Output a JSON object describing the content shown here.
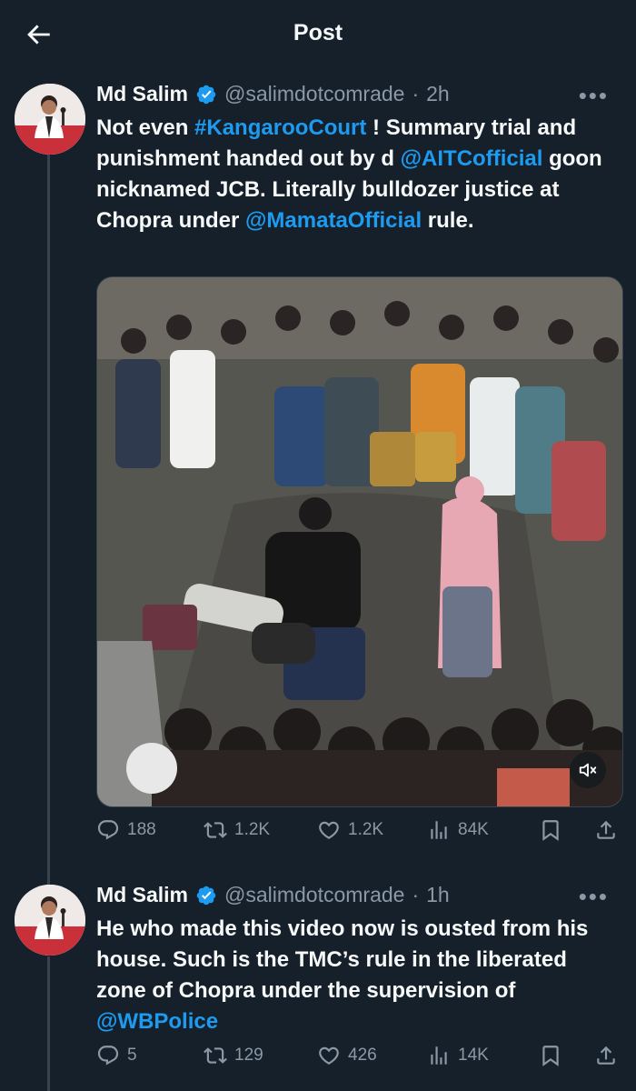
{
  "header": {
    "title": "Post"
  },
  "tweets": [
    {
      "name": "Md Salim",
      "handle": "@salimdotcomrade",
      "time": "2h",
      "text": {
        "p1": "Not even ",
        "hashtag": "#KangarooCourt",
        "p2": " ! Summary trial and punishment handed out by d ",
        "mention1": "@AITCofficial",
        "p3": " goon nicknamed JCB. Literally bulldozer justice at Chopra under ",
        "mention2": "@MamataOfficial",
        "p4": " rule."
      },
      "stats": {
        "replies": "188",
        "reposts": "1.2K",
        "likes": "1.2K",
        "views": "84K"
      }
    },
    {
      "name": "Md Salim",
      "handle": "@salimdotcomrade",
      "time": "1h",
      "text": {
        "p1": "He who made this video now is ousted from his house. Such is the TMC’s rule in the liberated zone of Chopra under the supervision of ",
        "mention1": "@WBPolice"
      },
      "stats": {
        "replies": "5",
        "reposts": "129",
        "likes": "426",
        "views": "14K"
      }
    }
  ],
  "separator": "·",
  "colors": {
    "background": "#15202b",
    "accent": "#1d9bf0",
    "muted": "#8b98a5",
    "verified": "#1d9bf0"
  }
}
